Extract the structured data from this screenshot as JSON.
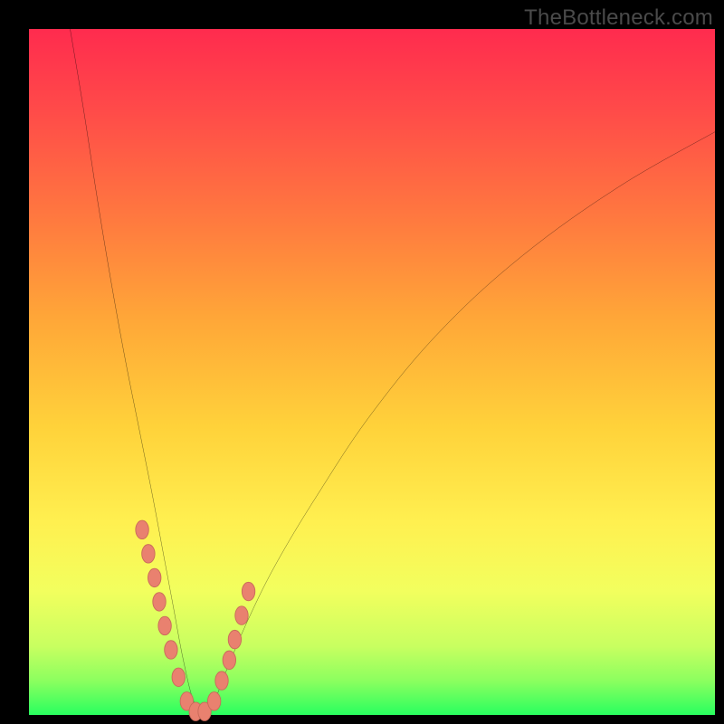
{
  "watermark": "TheBottleneck.com",
  "colors": {
    "frame": "#000000",
    "curve_stroke": "#000000",
    "marker_fill": "#e9816f",
    "marker_stroke": "#c96a5a",
    "gradient_top": "#ff2b4e",
    "gradient_bottom": "#29ff5f"
  },
  "chart_data": {
    "type": "line",
    "title": "",
    "xlabel": "",
    "ylabel": "",
    "xlim": [
      0,
      100
    ],
    "ylim": [
      0,
      100
    ],
    "series": [
      {
        "name": "bottleneck-curve",
        "x": [
          6,
          8,
          10,
          12,
          14,
          16,
          18,
          19.5,
          21,
          22.5,
          24,
          25.5,
          27,
          29,
          32,
          36,
          42,
          50,
          60,
          72,
          86,
          100
        ],
        "y": [
          100,
          88,
          75,
          63,
          52,
          42,
          32,
          24,
          16,
          8,
          2,
          0,
          2,
          7,
          14,
          22,
          32,
          44,
          56,
          67,
          77,
          85
        ]
      }
    ],
    "markers": {
      "name": "highlight-dots",
      "x": [
        16.5,
        17.4,
        18.3,
        19.0,
        19.8,
        20.7,
        21.8,
        23.0,
        24.3,
        25.6,
        27.0,
        28.1,
        29.2,
        30.0,
        31.0,
        32.0
      ],
      "y": [
        27.0,
        23.5,
        20.0,
        16.5,
        13.0,
        9.5,
        5.5,
        2.0,
        0.5,
        0.5,
        2.0,
        5.0,
        8.0,
        11.0,
        14.5,
        18.0
      ]
    }
  }
}
